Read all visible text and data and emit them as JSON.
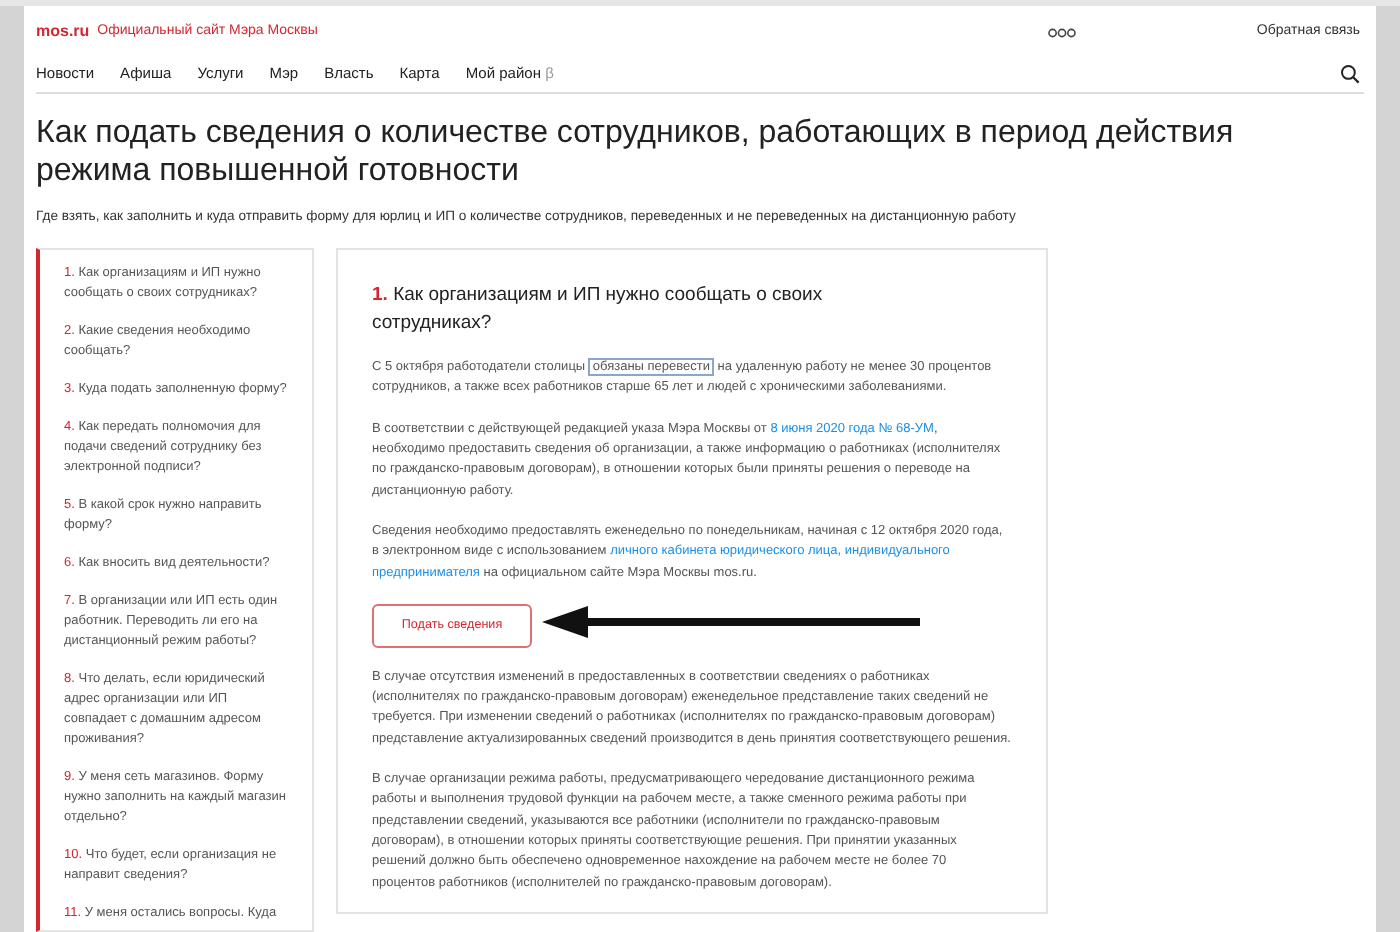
{
  "header": {
    "logo": "mos.ru",
    "tagline": "Официальный сайт Мэра Москвы",
    "feedback": "Обратная связь"
  },
  "nav": [
    {
      "label": "Новости"
    },
    {
      "label": "Афиша"
    },
    {
      "label": "Услуги"
    },
    {
      "label": "Мэр"
    },
    {
      "label": "Власть"
    },
    {
      "label": "Карта"
    },
    {
      "label": "Мой район",
      "badge": "β"
    }
  ],
  "title": "Как подать сведения о количестве сотрудников, работающих в период действия режима повышенной готовности",
  "subtitle": "Где взять, как заполнить и куда отправить форму для юрлиц и ИП о количестве сотрудников, переведенных и не переведенных на дистанционную работу",
  "toc": [
    {
      "number": "1.",
      "text": "Как организациям и ИП нужно сообщать о своих сотрудниках?"
    },
    {
      "number": "2.",
      "text": "Какие сведения необходимо сообщать?"
    },
    {
      "number": "3.",
      "text": "Куда подать заполненную форму?"
    },
    {
      "number": "4.",
      "text": "Как передать полномочия для подачи сведений сотруднику без электронной подписи?"
    },
    {
      "number": "5.",
      "text": "В какой срок нужно направить форму?"
    },
    {
      "number": "6.",
      "text": "Как вносить вид деятельности?"
    },
    {
      "number": "7.",
      "text": "В организации или ИП есть один работник. Переводить ли его на дистанционный режим работы?"
    },
    {
      "number": "8.",
      "text": "Что делать, если юридический адрес организации или ИП совпадает с домашним адресом проживания?"
    },
    {
      "number": "9.",
      "text": "У меня сеть магазинов. Форму нужно заполнить на каждый магазин отдельно?"
    },
    {
      "number": "10.",
      "text": "Что будет, если организация не направит сведения?"
    },
    {
      "number": "11.",
      "text": "У меня остались вопросы. Куда"
    }
  ],
  "section": {
    "number": "1.",
    "heading": "Как организациям и ИП нужно сообщать о своих сотрудниках?",
    "paragraphs_before": [
      [
        {
          "kind": "plain",
          "text": "С 5 октября работодатели столицы "
        },
        {
          "kind": "boxed",
          "text": "обязаны перевести"
        },
        {
          "kind": "plain",
          "text": " на удаленную работу не менее 30 процентов сотрудников, а также всех работников старше 65 лет и людей с хроническими заболеваниями."
        }
      ],
      [
        {
          "kind": "plain",
          "text": "В соответствии с действующей редакцией указа Мэра Москвы от "
        },
        {
          "kind": "link",
          "text": "8 июня 2020 года № 68-УМ"
        },
        {
          "kind": "plain",
          "text": ", необходимо предоставить сведения об организации, а также информацию о работниках (исполнителях по гражданско-правовым договорам), в отношении которых были приняты решения о переводе на дистанционную работу."
        }
      ],
      [
        {
          "kind": "plain",
          "text": "Сведения необходимо предоставлять еженедельно по понедельникам, начиная с 12 октября 2020 года, в электронном виде с использованием "
        },
        {
          "kind": "link",
          "text": "личного кабинета юридического лица, индивидуального"
        },
        {
          "kind": "link",
          "text": "предпринимателя"
        },
        {
          "kind": "plain",
          "text": " на официальном сайте Мэра Москвы mos.ru."
        }
      ]
    ],
    "button": "Подать сведения",
    "paragraphs_after": [
      [
        {
          "kind": "plain",
          "text": "В случае отсутствия изменений в предоставленных в соответствии сведениях о работниках (исполнителях по гражданско-правовым договорам) еженедельное представление таких сведений не требуется. При изменении сведений о работниках (исполнителях по гражданско-правовым договорам) представление актуализированных сведений производится в день принятия соответствующего решения."
        }
      ],
      [
        {
          "kind": "plain",
          "text": "В случае организации режима работы, предусматривающего чередование дистанционного режима работы и выполнения трудовой функции на рабочем месте, а также сменного режима работы при представлении сведений, указываются все работники (исполнители по гражданско-правовым договорам), в отношении которых приняты соответствующие решения. При принятии указанных решений должно быть обеспечено одновременное нахождение на рабочем месте не более 70 процентов работников (исполнителей по гражданско-правовым договорам)."
        }
      ]
    ]
  }
}
